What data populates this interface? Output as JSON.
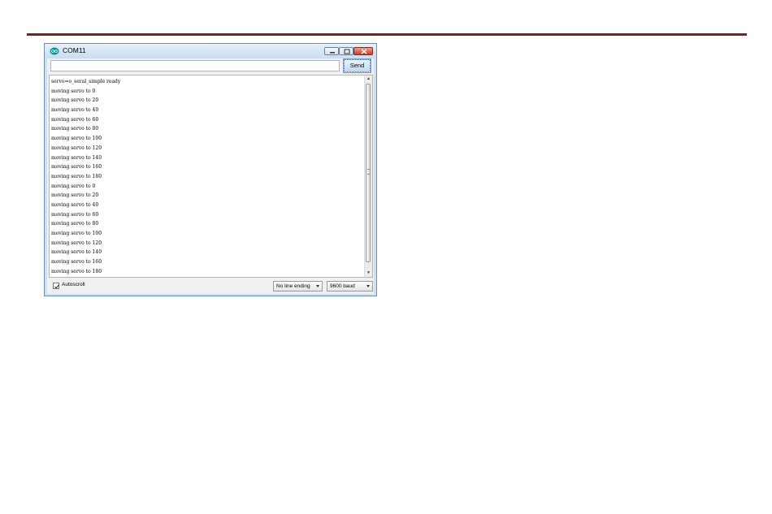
{
  "window": {
    "title": "COM11",
    "icon": "arduino-icon",
    "controls": {
      "minimize": "minimize-icon",
      "maximize": "maximize-icon",
      "close": "close-icon"
    }
  },
  "input": {
    "value": "",
    "send_label": "Send"
  },
  "output": {
    "lines": [
      "servo=o_seral_simple ready",
      "moving servo to 0",
      "moving servo to 20",
      "moving servo to 40",
      "moving servo to 60",
      "moving servo to 80",
      "moving servo to 100",
      "moving servo to 120",
      "moving servo to 140",
      "moving servo to 160",
      "moving servo to 180",
      "moving servo to 0",
      "moving servo to 20",
      "moving servo to 40",
      "moving servo to 60",
      "moving servo to 80",
      "moving servo to 100",
      "moving servo to 120",
      "moving servo to 140",
      "moving servo to 160",
      "moving servo to 180"
    ]
  },
  "footer": {
    "autoscroll_label": "Autoscroll",
    "autoscroll_checked": true,
    "line_ending": "No line ending",
    "baud_rate": "9600 baud"
  },
  "colors": {
    "rule": "#7b1e1e",
    "arduino_teal": "#00979c",
    "close_red": "#c0432f"
  }
}
